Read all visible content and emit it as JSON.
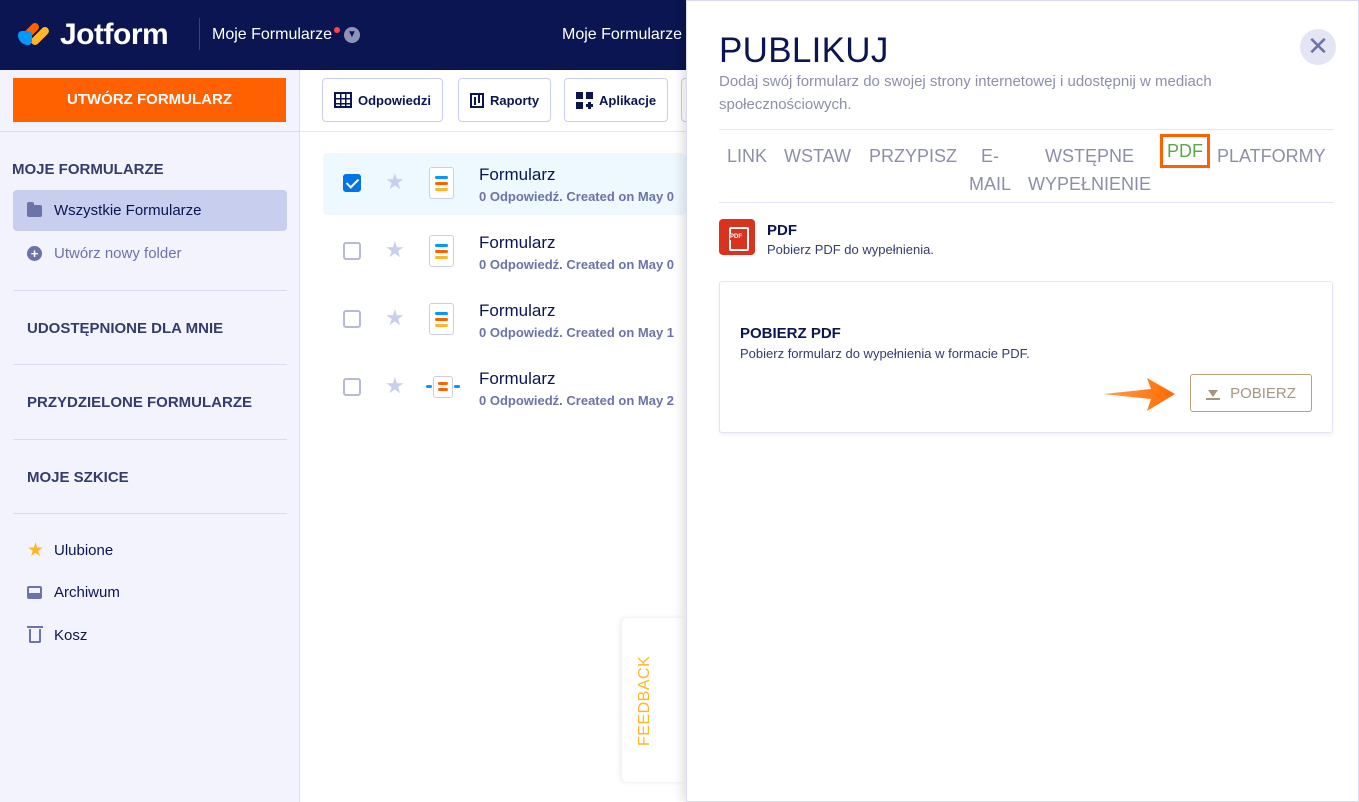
{
  "topbar": {
    "logo": "Jotform",
    "title": "Moje Formularze",
    "title_center": "Moje Formularze"
  },
  "sidebar": {
    "create_button": "UTWÓRZ FORMULARZ",
    "my_forms_heading": "MOJE FORMULARZE",
    "all_forms": "Wszystkie Formularze",
    "new_folder": "Utwórz nowy folder",
    "shared": "UDOSTĘPNIONE DLA MNIE",
    "assigned": "PRZYDZIELONE FORMULARZE",
    "drafts": "MOJE SZKICE",
    "favorites": "Ulubione",
    "archive": "Archiwum",
    "trash": "Kosz"
  },
  "toolbar": {
    "responses": "Odpowiedzi",
    "reports": "Raporty",
    "apps": "Aplikacje"
  },
  "forms": [
    {
      "title": "Formularz",
      "meta": "0 Odpowiedź. Created on May 0",
      "selected": true
    },
    {
      "title": "Formularz",
      "meta": "0 Odpowiedź. Created on May 0",
      "selected": false
    },
    {
      "title": "Formularz",
      "meta": "0 Odpowiedź. Created on May 1",
      "selected": false
    },
    {
      "title": "Formularz",
      "meta": "0 Odpowiedź. Created on May 2",
      "selected": false
    }
  ],
  "feedback": "FEEDBACK",
  "publish": {
    "title": "PUBLIKUJ",
    "description": "Dodaj swój formularz do swojej strony internetowej i udostępnij w mediach społecznościowych.",
    "tabs": {
      "link": "LINK",
      "embed": "WSTAW",
      "assign": "PRZYPISZ",
      "email_1": "E-",
      "email_2": "MAIL",
      "prefill_1": "WSTĘPNE",
      "prefill_2": "WYPEŁNIENIE",
      "pdf": "PDF",
      "platforms": "PLATFORMY"
    },
    "pdf_badge": "PDF",
    "pdf_title": "PDF",
    "pdf_subtitle": "Pobierz PDF do wypełnienia.",
    "download_title": "POBIERZ PDF",
    "download_subtitle": "Pobierz formularz do wypełnienia w formacie PDF.",
    "download_button": "POBIERZ"
  },
  "colors": {
    "navy": "#0a1551",
    "orange": "#ff6100",
    "active_tab_text": "#5ca74a",
    "pdf_red": "#d9321f"
  }
}
